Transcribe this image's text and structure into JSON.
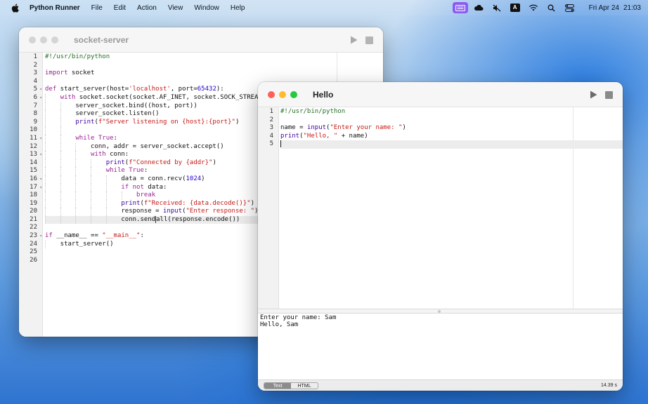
{
  "menubar": {
    "app_name": "Python Runner",
    "items": [
      "File",
      "Edit",
      "Action",
      "View",
      "Window",
      "Help"
    ],
    "tray_icons": [
      "keyboard-brightness-icon",
      "cloud-icon",
      "mute-icon",
      "input-source-icon",
      "wifi-icon",
      "search-icon",
      "control-center-icon"
    ],
    "input_source_letter": "A",
    "date": "Fri Apr 24",
    "time": "21:03"
  },
  "socket_window": {
    "title": "socket-server",
    "line_numbers": [
      "1",
      "2",
      "3",
      "4",
      "5",
      "6",
      "7",
      "8",
      "9",
      "10",
      "11",
      "12",
      "13",
      "14",
      "15",
      "16",
      "17",
      "18",
      "19",
      "20",
      "21",
      "22",
      "23",
      "24",
      "25",
      "26"
    ],
    "fold_markers": [
      "5",
      "6",
      "11",
      "13",
      "16",
      "17",
      "23"
    ]
  },
  "hello_window": {
    "title": "Hello",
    "line_numbers": [
      "1",
      "2",
      "3",
      "4",
      "5"
    ],
    "console_lines": [
      "Enter your name: Sam",
      "Hello, Sam"
    ],
    "tabs": [
      "Text",
      "HTML"
    ],
    "active_tab": "Text",
    "elapsed": "14.39 s"
  },
  "colors": {
    "close": "#ff5f57",
    "minimize": "#febc2e",
    "zoom": "#28c840",
    "inactive_light": "#d4d4d4",
    "tray_active": "#8a5cf0",
    "keyword": "#9b2393",
    "string": "#c41a16",
    "number": "#1c00cf",
    "comment": "#236e25"
  }
}
